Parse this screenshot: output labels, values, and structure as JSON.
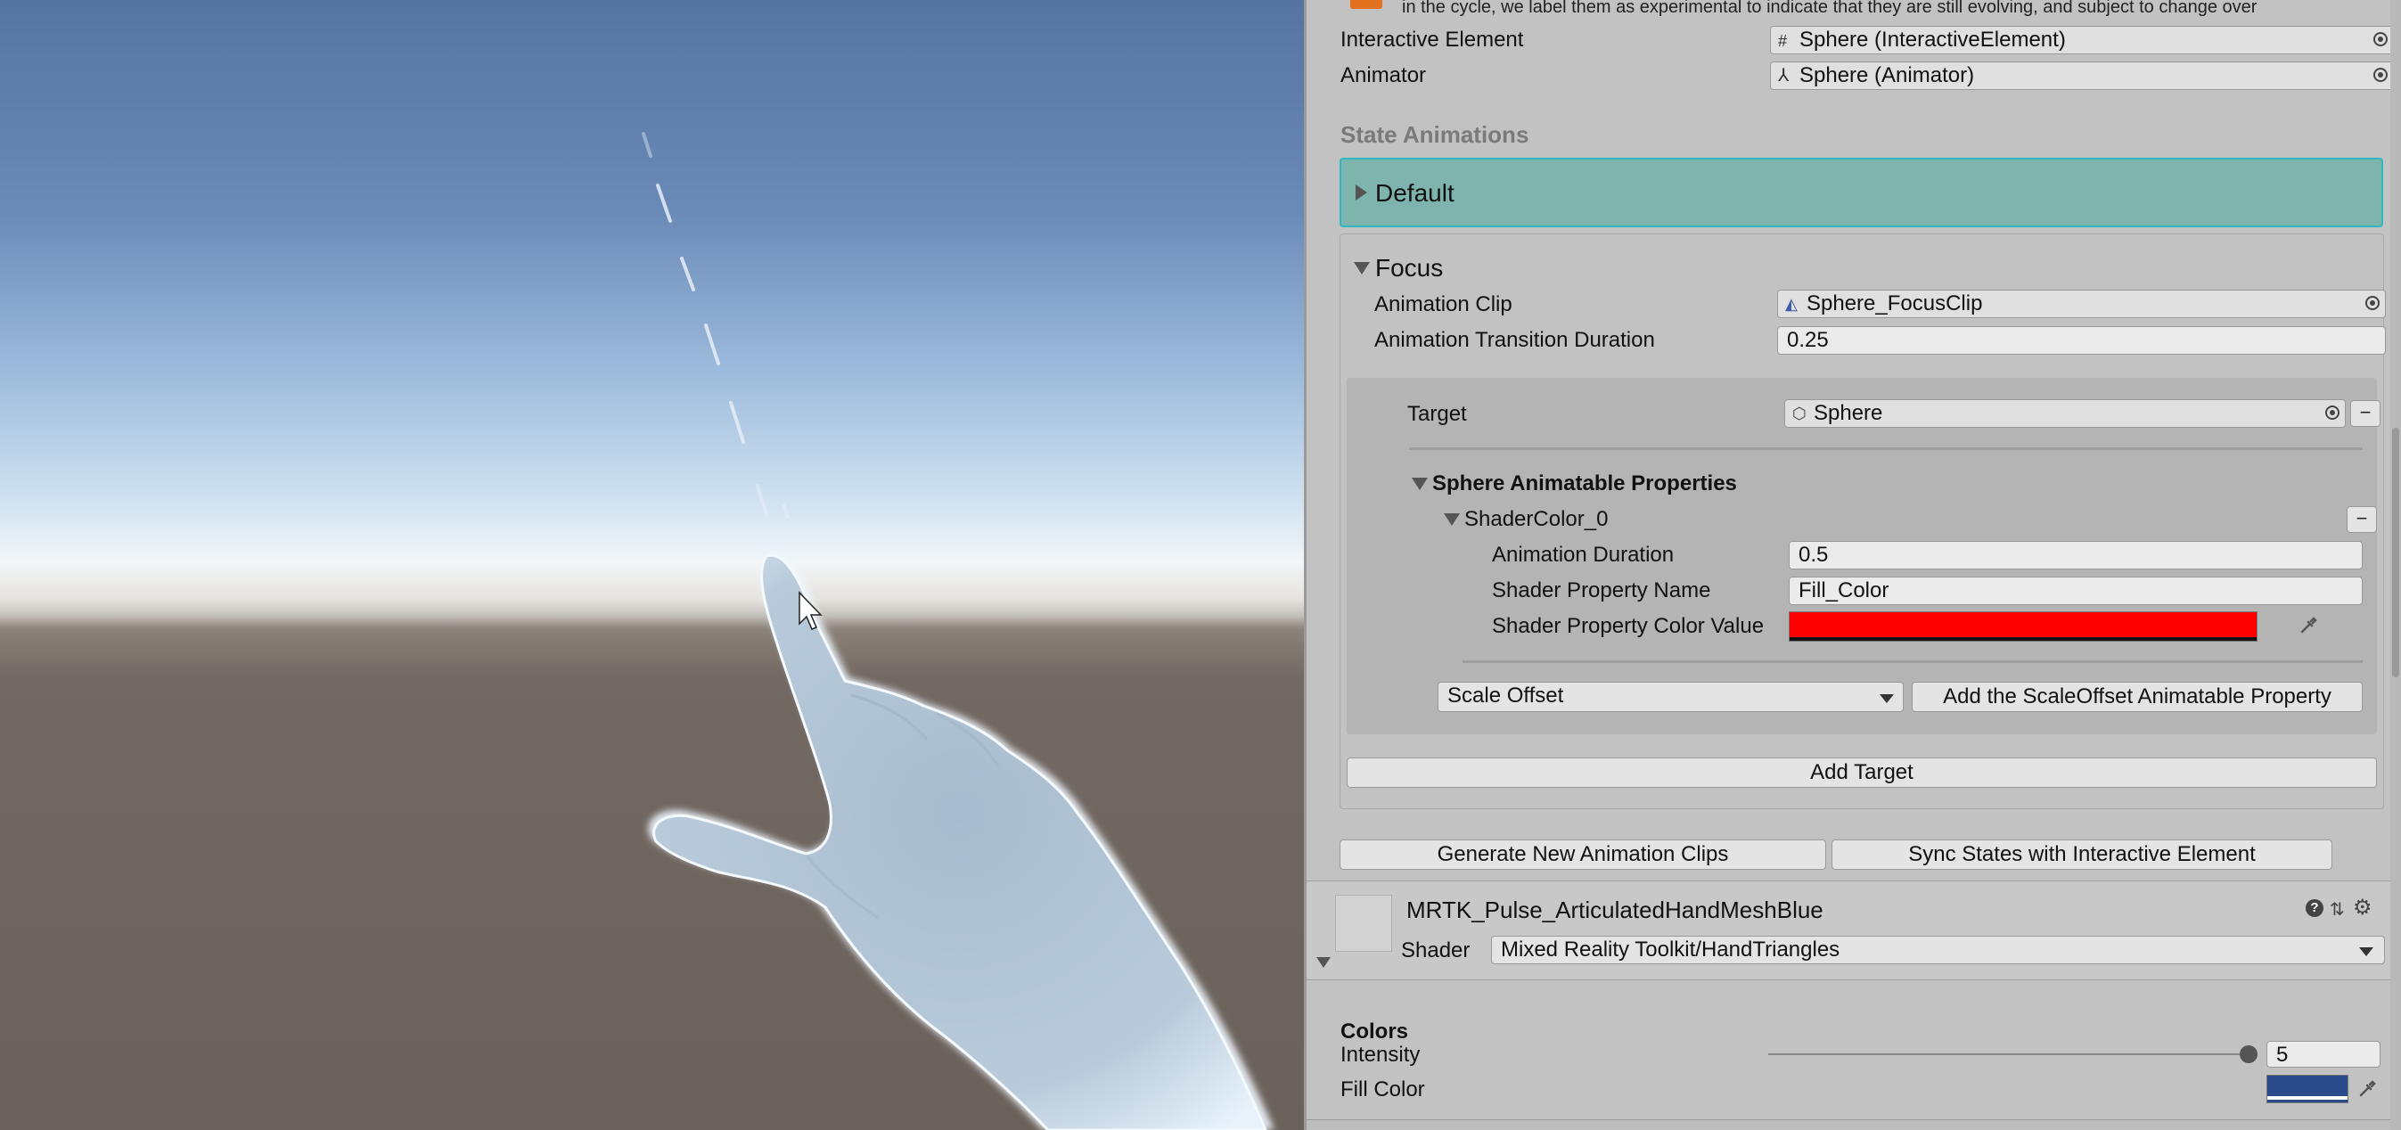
{
  "inspector": {
    "experimental_note": "in the cycle, we label them as experimental to indicate that they are still evolving, and subject to change over",
    "interactive_element": {
      "label": "Interactive Element",
      "value": "Sphere (InteractiveElement)"
    },
    "animator": {
      "label": "Animator",
      "value": "Sphere (Animator)"
    },
    "state_animations_header": "State Animations",
    "default_state": {
      "label": "Default"
    },
    "focus_state": {
      "label": "Focus",
      "animation_clip": {
        "label": "Animation Clip",
        "value": "Sphere_FocusClip"
      },
      "transition_duration": {
        "label": "Animation Transition Duration",
        "value": "0.25"
      },
      "target": {
        "label": "Target",
        "value": "Sphere",
        "remove": "−"
      },
      "animatable_header": "Sphere Animatable Properties",
      "shader_color": {
        "label": "ShaderColor_0",
        "remove": "−",
        "animation_duration": {
          "label": "Animation Duration",
          "value": "0.5"
        },
        "property_name": {
          "label": "Shader Property Name",
          "value": "Fill_Color"
        },
        "color_value": {
          "label": "Shader Property Color Value",
          "color": "#ff0000"
        }
      },
      "property_dropdown": {
        "value": "Scale Offset"
      },
      "add_property_button": "Add the ScaleOffset Animatable Property",
      "add_target_button": "Add Target"
    },
    "generate_button": "Generate New Animation Clips",
    "sync_button": "Sync States with Interactive Element",
    "material": {
      "name": "MRTK_Pulse_ArticulatedHandMeshBlue",
      "shader_label": "Shader",
      "shader_value": "Mixed Reality Toolkit/HandTriangles"
    },
    "colors": {
      "header": "Colors",
      "intensity": {
        "label": "Intensity",
        "value": "5"
      },
      "fill_color": {
        "label": "Fill Color",
        "color": "#2b4a8c"
      }
    }
  },
  "colors": {
    "accent_teal": "#7fb3ad",
    "accent_border": "#2fb8c0",
    "inspector_bg": "#c2c2c2"
  }
}
